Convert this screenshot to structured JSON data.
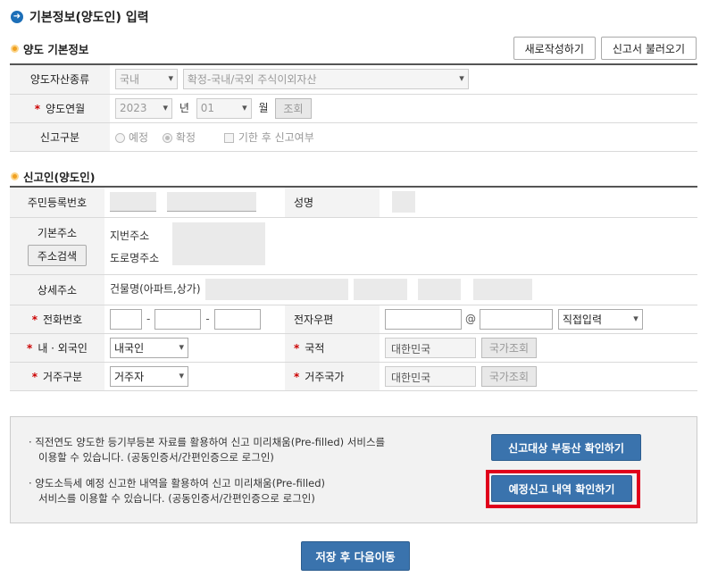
{
  "page": {
    "title": "기본정보(양도인) 입력"
  },
  "section1": {
    "title": "양도 기본정보",
    "new_button": "새로작성하기",
    "load_button": "신고서 불러오기",
    "asset_type": {
      "label": "양도자산종류",
      "country": "국내",
      "type": "확정-국내/국외 주식이외자산"
    },
    "transfer_date": {
      "label": "양도연월",
      "year": "2023",
      "year_unit": "년",
      "month": "01",
      "month_unit": "월",
      "lookup_button": "조회"
    },
    "report_type": {
      "label": "신고구분",
      "option_scheduled": "예정",
      "option_confirmed": "확정",
      "late_checkbox": "기한 후 신고여부"
    }
  },
  "section2": {
    "title": "신고인(양도인)",
    "rrn_label": "주민등록번호",
    "name_label": "성명",
    "address_label": "기본주소",
    "address_search_button": "주소검색",
    "lot_address_label": "지번주소",
    "road_address_label": "도로명주소",
    "detail_address_label": "상세주소",
    "building_name_label": "건물명(아파트,상가)",
    "phone_label": "전화번호",
    "email_label": "전자우편",
    "email_domain_select": "직접입력",
    "nationality_type_label": "내 · 외국인",
    "nationality_type_value": "내국인",
    "country_label": "국적",
    "country_value": "대한민국",
    "country_lookup_button": "국가조회",
    "residence_type_label": "거주구분",
    "residence_type_value": "거주자",
    "residence_country_label": "거주국가",
    "residence_country_value": "대한민국",
    "residence_lookup_button": "국가조회"
  },
  "info": {
    "line1a": "· 직전연도 양도한 등기부등본 자료를 활용하여 신고 미리채움(Pre-filled) 서비스를",
    "line1b": "이용할 수 있습니다. (공동인증서/간편인증으로 로그인)",
    "line2a": "· 양도소득세 예정 신고한 내역을 활용하여 신고 미리채움(Pre-filled)",
    "line2b": "서비스를 이용할 수 있습니다. (공동인증서/간편인증으로 로그인)",
    "property_button": "신고대상 부동산 확인하기",
    "scheduled_button": "예정신고 내역 확인하기"
  },
  "save_button": "저장 후 다음이동",
  "colors": {
    "accent_blue": "#3a73ad",
    "highlight_red": "#e0001b",
    "section_dot": "#f0a020"
  }
}
